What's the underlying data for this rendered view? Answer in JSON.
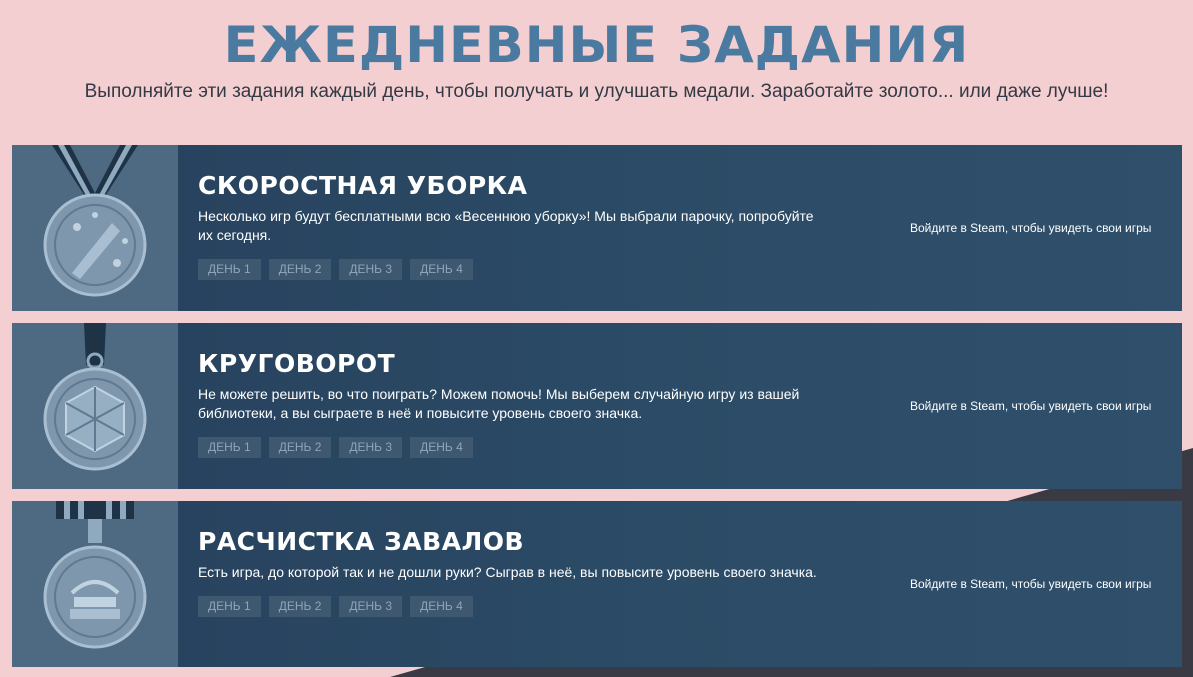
{
  "header": {
    "title": "ЕЖЕДНЕВНЫЕ ЗАДАНИЯ",
    "subtitle": "Выполняйте эти задания каждый день, чтобы получать и улучшать медали. Заработайте золото... или даже лучше!"
  },
  "quests": [
    {
      "title": "СКОРОСТНАЯ УБОРКА",
      "description": "Несколько игр будут бесплатными всю «Весеннюю уборку»! Мы выбрали парочку, попробуйте их сегодня.",
      "days": [
        "ДЕНЬ 1",
        "ДЕНЬ 2",
        "ДЕНЬ 3",
        "ДЕНЬ 4"
      ],
      "login_text": "Войдите в Steam, чтобы увидеть свои игры",
      "medal_icon": "rocket-star-medal-icon"
    },
    {
      "title": "КРУГОВОРОТ",
      "description": "Не можете решить, во что поиграть? Можем помочь! Мы выберем случайную игру из вашей библиотеки, а вы сыграете в неё и повысите уровень своего значка.",
      "days": [
        "ДЕНЬ 1",
        "ДЕНЬ 2",
        "ДЕНЬ 3",
        "ДЕНЬ 4"
      ],
      "login_text": "Войдите в Steam, чтобы увидеть свои игры",
      "medal_icon": "dice-medal-icon"
    },
    {
      "title": "РАСЧИСТКА ЗАВАЛОВ",
      "description": "Есть игра, до которой так и не дошли руки? Сыграв в неё, вы повысите уровень своего значка.",
      "days": [
        "ДЕНЬ 1",
        "ДЕНЬ 2",
        "ДЕНЬ 3",
        "ДЕНЬ 4"
      ],
      "login_text": "Войдите в Steam, чтобы увидеть свои игры",
      "medal_icon": "book-stack-medal-icon"
    }
  ],
  "colors": {
    "background": "#f4cfd1",
    "title": "#4b7aa0",
    "panel": "#2b4b66",
    "medal_panel": "#4d6a82",
    "day_button": "#3e5870"
  }
}
